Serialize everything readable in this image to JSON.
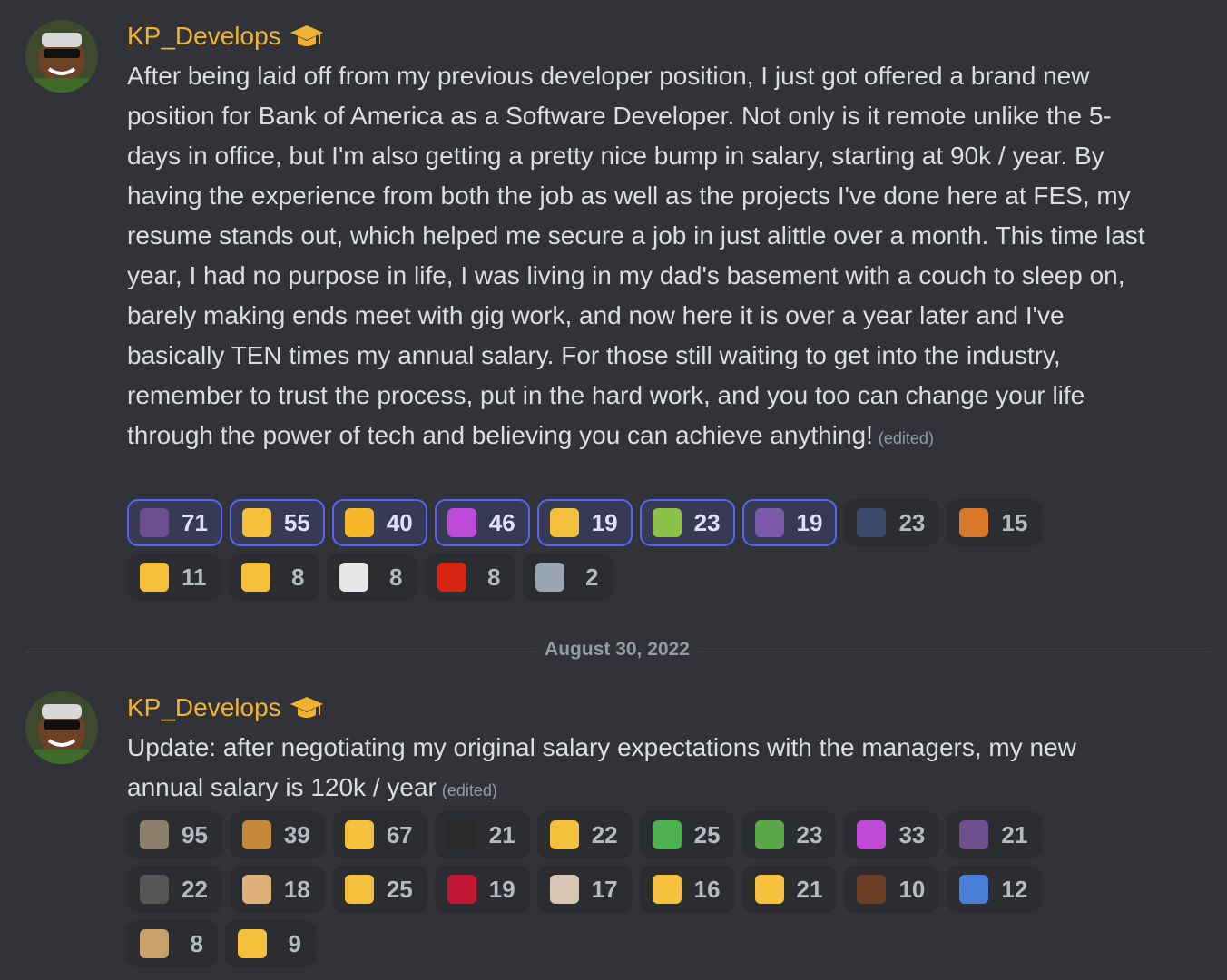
{
  "messages": [
    {
      "username": "KP_Develops",
      "badge_icon": "graduation-cap-icon",
      "text": "After being laid off from my previous developer position, I just got offered a brand new position for Bank of America as a Software Developer. Not only is it remote unlike the 5-days in office, but I'm also getting a pretty nice bump in salary, starting at 90k / year. By having the experience from both the job as well as the projects I've done here at FES, my resume stands out, which helped me secure a job in just alittle over a month. This time last year, I had no purpose in life, I was living in my dad's basement with a couch to sleep on, barely making ends meet with gig work, and now here it is over a year later and I've basically TEN times my annual salary. For those still waiting to get into the industry, remember to trust the process, put in the hard work, and you too can change your life through the power of tech and believing you can achieve anything!",
      "edited_label": "(edited)",
      "reactions": [
        {
          "emoji": "thanos-icon",
          "count": "71",
          "active": true,
          "color": "#6b4f8e"
        },
        {
          "emoji": "thumbs-up-icon",
          "count": "55",
          "active": true,
          "color": "#f5c13d"
        },
        {
          "emoji": "party-face-icon",
          "count": "40",
          "active": true,
          "color": "#f7b52a"
        },
        {
          "emoji": "purple-fire-icon",
          "count": "46",
          "active": true,
          "color": "#c04ad8"
        },
        {
          "emoji": "money-mouth-face-icon",
          "count": "19",
          "active": true,
          "color": "#f5c13d"
        },
        {
          "emoji": "money-with-wings-icon",
          "count": "23",
          "active": true,
          "color": "#8bc34a"
        },
        {
          "emoji": "thanos-snap-icon",
          "count": "19",
          "active": true,
          "color": "#7a5aa8"
        },
        {
          "emoji": "storm-cloud-icon",
          "count": "23",
          "active": false,
          "color": "#3a4a6b"
        },
        {
          "emoji": "orange-cat-icon",
          "count": "15",
          "active": false,
          "color": "#d9782a"
        },
        {
          "emoji": "fist-bump-icon",
          "count": "11",
          "active": false,
          "color": "#f5c13d"
        },
        {
          "emoji": "clapping-hands-icon",
          "count": "8",
          "active": false,
          "color": "#f5c13d"
        },
        {
          "emoji": "ghost-face-icon",
          "count": "8",
          "active": false,
          "color": "#e6e6e6"
        },
        {
          "emoji": "bulgaria-flag-icon",
          "count": "8",
          "active": false,
          "color": "#d62612"
        },
        {
          "emoji": "trash-can-icon",
          "count": "2",
          "active": false,
          "color": "#9aa6b2"
        }
      ]
    },
    {
      "username": "KP_Develops",
      "badge_icon": "graduation-cap-icon",
      "text": "Update: after negotiating my original salary expectations with the managers, my new annual salary is 120k / year",
      "edited_label": "(edited)",
      "reactions": [
        {
          "emoji": "face-photo-icon",
          "count": "95",
          "active": false,
          "color": "#8a7f6b"
        },
        {
          "emoji": "smug-face-icon",
          "count": "39",
          "active": false,
          "color": "#c48a3a"
        },
        {
          "emoji": "thumbs-up-icon",
          "count": "67",
          "active": false,
          "color": "#f5c13d"
        },
        {
          "emoji": "dark-cat-icon",
          "count": "21",
          "active": false,
          "color": "#2a2a2a"
        },
        {
          "emoji": "angel-thinking-icon",
          "count": "22",
          "active": false,
          "color": "#f5c13d"
        },
        {
          "emoji": "stick-figure-icon",
          "count": "25",
          "active": false,
          "color": "#4caf50"
        },
        {
          "emoji": "frog-icon",
          "count": "23",
          "active": false,
          "color": "#5aa84a"
        },
        {
          "emoji": "purple-fire-icon",
          "count": "33",
          "active": false,
          "color": "#c04ad8"
        },
        {
          "emoji": "thanos-icon",
          "count": "21",
          "active": false,
          "color": "#6b4f8e"
        },
        {
          "emoji": "sunglasses-man-icon",
          "count": "22",
          "active": false,
          "color": "#555555"
        },
        {
          "emoji": "bread-icon",
          "count": "18",
          "active": false,
          "color": "#e0b07a"
        },
        {
          "emoji": "blushing-face-icon",
          "count": "25",
          "active": false,
          "color": "#f5c13d"
        },
        {
          "emoji": "red-crystal-icon",
          "count": "19",
          "active": false,
          "color": "#c21835"
        },
        {
          "emoji": "pale-face-icon",
          "count": "17",
          "active": false,
          "color": "#d9c7b5"
        },
        {
          "emoji": "fist-bump-icon",
          "count": "16",
          "active": false,
          "color": "#f5c13d"
        },
        {
          "emoji": "flexed-biceps-icon",
          "count": "21",
          "active": false,
          "color": "#f5c13d"
        },
        {
          "emoji": "man-face-icon",
          "count": "10",
          "active": false,
          "color": "#6b3f26"
        },
        {
          "emoji": "rocket-icon",
          "count": "12",
          "active": false,
          "color": "#4a7fd8"
        },
        {
          "emoji": "sunglasses-pug-icon",
          "count": "8",
          "active": false,
          "color": "#c9a26b"
        },
        {
          "emoji": "slightly-smiling-face-icon",
          "count": "9",
          "active": false,
          "color": "#f5c13d"
        }
      ]
    }
  ],
  "date_divider": "August 30, 2022"
}
